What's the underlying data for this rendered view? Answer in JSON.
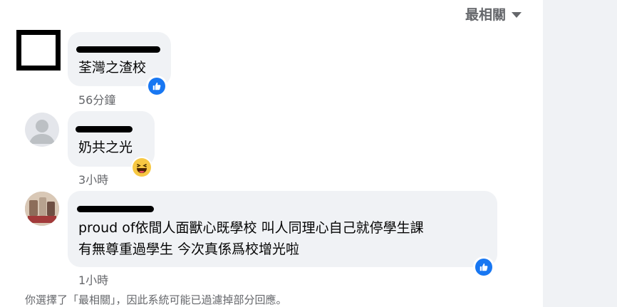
{
  "sort": {
    "label": "最相關"
  },
  "comments": [
    {
      "text_lines": [
        "荃灣之渣校"
      ],
      "time": "56分鐘",
      "reaction": "like-icon"
    },
    {
      "text_lines": [
        "奶共之光"
      ],
      "time": "3小時",
      "reaction": "haha-icon"
    },
    {
      "text_lines": [
        "proud of依間人面獸心既學校 叫人同理心自己就停學生課",
        "有無尊重過學生 今次真係爲校增光啦"
      ],
      "time": "1小時",
      "reaction": "like-icon"
    }
  ],
  "footer": {
    "note": "你選擇了「最相關」，因此系統可能已過濾掉部分回應。"
  },
  "colors": {
    "like": "#1877f2",
    "haha": "#f7c843",
    "bubble": "#f0f2f5",
    "meta": "#65676b"
  }
}
